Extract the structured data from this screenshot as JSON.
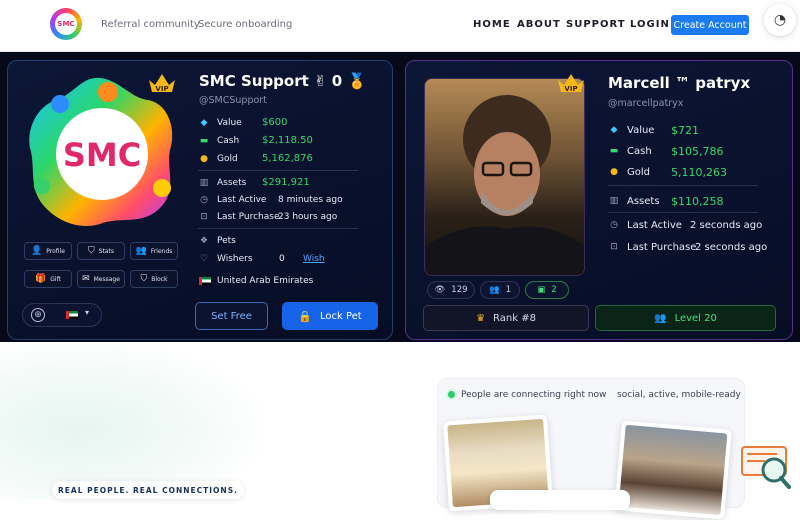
{
  "nav": {
    "logo_text": "SMC",
    "taglines": [
      "Referral community",
      "Secure onboarding"
    ],
    "links": [
      "HOME",
      "ABOUT",
      "SUPPORT",
      "LOGIN"
    ],
    "cta": "Create Account",
    "theme_icon": "spinner-icon"
  },
  "card1": {
    "logo_text": "SMC",
    "vip": "VIP",
    "name": "SMC Support ✌ 0 🏅",
    "handle": "@SMCSupport",
    "stats": [
      {
        "icon": "diamond-icon",
        "label": "Value",
        "value": "$600"
      },
      {
        "icon": "cash-icon",
        "label": "Cash",
        "value": "$2,118.50"
      },
      {
        "icon": "gold-icon",
        "label": "Gold",
        "value": "5,162,876"
      }
    ],
    "assets": {
      "label": "Assets",
      "value": "$291,921"
    },
    "last_active": {
      "label": "Last Active",
      "value": "8 minutes ago"
    },
    "last_purchase": {
      "label": "Last Purchase",
      "value": "23 hours ago"
    },
    "pets_label": "Pets",
    "wishers": {
      "label": "Wishers",
      "count": "0",
      "action": "Wish"
    },
    "country": "United Arab Emirates",
    "actions": [
      "Profile",
      "Stats",
      "Friends",
      "Gift",
      "Message",
      "Block"
    ],
    "set_free": "Set Free",
    "lock_pet": "Lock Pet"
  },
  "card2": {
    "vip": "VIP",
    "name": "Marcell ™ patryx",
    "handle": "@marcellpatryx",
    "stats": [
      {
        "icon": "diamond-icon",
        "label": "Value",
        "value": "$721"
      },
      {
        "icon": "cash-icon",
        "label": "Cash",
        "value": "$105,786"
      },
      {
        "icon": "gold-icon",
        "label": "Gold",
        "value": "5,110,263"
      }
    ],
    "assets": {
      "label": "Assets",
      "value": "$110,258"
    },
    "last_active": {
      "label": "Last Active",
      "value": "2 seconds ago"
    },
    "last_purchase": {
      "label": "Last Purchase",
      "value": "2 seconds ago"
    },
    "views": "129",
    "friends": "1",
    "messages": "2",
    "rank": "Rank #8",
    "level": "Level 20"
  },
  "lower": {
    "status": "People are connecting right now",
    "features": "social, active, mobile-ready",
    "badge": "REAL PEOPLE. REAL CONNECTIONS."
  },
  "colors": {
    "accent": "#1b7cf2",
    "money": "#36d86a",
    "gold": "#f5b81b",
    "navy": "#05091a"
  }
}
